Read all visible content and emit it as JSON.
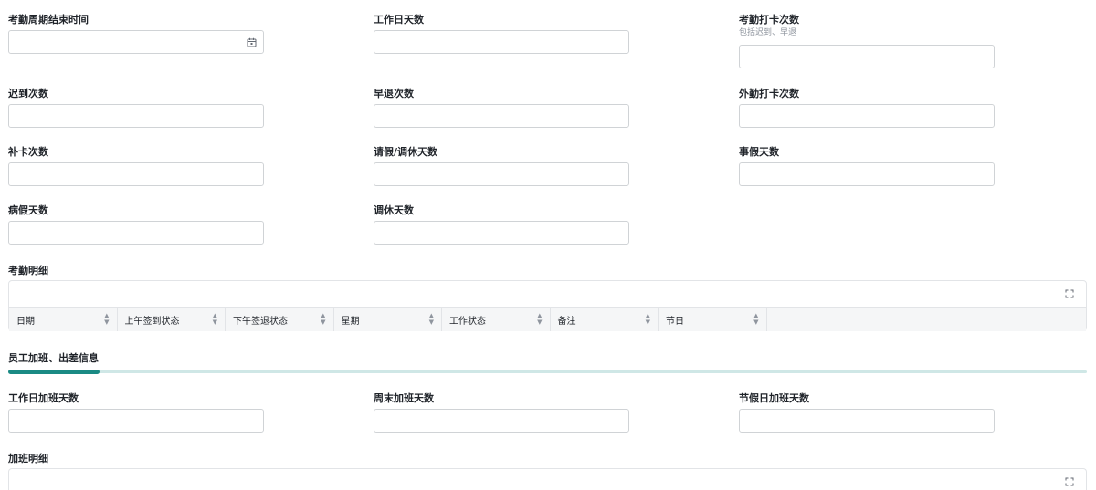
{
  "fields": {
    "cycle_end": {
      "label": "考勤周期结束时间",
      "value": ""
    },
    "workdays": {
      "label": "工作日天数",
      "value": ""
    },
    "punch_count": {
      "label": "考勤打卡次数",
      "hint": "包括迟到、早退",
      "value": ""
    },
    "late_count": {
      "label": "迟到次数",
      "value": ""
    },
    "early_leave_count": {
      "label": "早退次数",
      "value": ""
    },
    "field_punch_count": {
      "label": "外勤打卡次数",
      "value": ""
    },
    "makeup_punch_count": {
      "label": "补卡次数",
      "value": ""
    },
    "leave_days": {
      "label": "请假/调休天数",
      "value": ""
    },
    "personal_leave_days": {
      "label": "事假天数",
      "value": ""
    },
    "sick_leave_days": {
      "label": "病假天数",
      "value": ""
    },
    "comp_leave_days": {
      "label": "调休天数",
      "value": ""
    },
    "weekday_overtime_days": {
      "label": "工作日加班天数",
      "value": ""
    },
    "weekend_overtime_days": {
      "label": "周末加班天数",
      "value": ""
    },
    "holiday_overtime_days": {
      "label": "节假日加班天数",
      "value": ""
    }
  },
  "attendance_detail": {
    "label": "考勤明细",
    "columns": [
      "日期",
      "上午签到状态",
      "下午签退状态",
      "星期",
      "工作状态",
      "备注",
      "节日"
    ]
  },
  "tab": {
    "label": "员工加班、出差信息",
    "accent_color": "#1a8a84"
  },
  "overtime_detail": {
    "label": "加班明细"
  },
  "icons": {
    "calendar": "calendar-icon",
    "expand": "expand-icon",
    "sort": "sort-icon"
  }
}
